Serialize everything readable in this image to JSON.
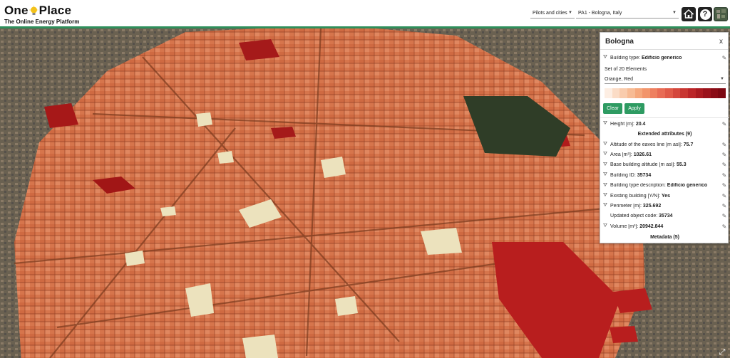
{
  "header": {
    "logo_part1": "One",
    "logo_part2": "Place",
    "subtitle": "The Online Energy Platform",
    "pilots_select": "Pilots and cities",
    "area_select": "PA1 - Bologna, Italy",
    "home_icon": "home-icon",
    "help_label": "?",
    "map_icon": "map-thumbnail-icon"
  },
  "panel": {
    "title": "Bologna",
    "close_label": "x",
    "building_type_label": "Building type:",
    "building_type_value": "Edificio generico",
    "set_label": "Set of 20 Elements",
    "color_scheme": "Orange, Red",
    "ramp_colors": [
      "#fdeee3",
      "#fbdcc6",
      "#f9ccad",
      "#f7bb94",
      "#f5a87c",
      "#f2956b",
      "#ee8060",
      "#e86c55",
      "#e05a48",
      "#d4473c",
      "#c83631",
      "#bb2528",
      "#aa1a20",
      "#9a121b",
      "#8a0c16",
      "#7d0812"
    ],
    "clear_button": "Clear",
    "apply_button": "Apply",
    "height_label": "Height [m]:",
    "height_value": "20.4",
    "extended_header": "Extended attributes (9)",
    "attributes": [
      {
        "label": "Altitude of the eaves line [m asl]:",
        "value": "75.7"
      },
      {
        "label": "Area [m²]:",
        "value": "1026.61"
      },
      {
        "label": "Base building altitude [m asl]:",
        "value": "55.3"
      },
      {
        "label": "Building ID:",
        "value": "35734"
      },
      {
        "label": "Building type description:",
        "value": "Edificio generico"
      },
      {
        "label": "Existing building [Y/N]:",
        "value": "Yes"
      },
      {
        "label": "Perimeter [m]:",
        "value": "325.692"
      },
      {
        "label": "Updated object code:",
        "value": "35734"
      },
      {
        "label": "Volume [m³]:",
        "value": "20942.844"
      }
    ],
    "metadata_header": "Metadata (5)"
  },
  "map": {
    "building_color": "#d6754c",
    "highlight_color": "#b81e1e",
    "fullscreen_icon": "fullscreen-icon"
  }
}
